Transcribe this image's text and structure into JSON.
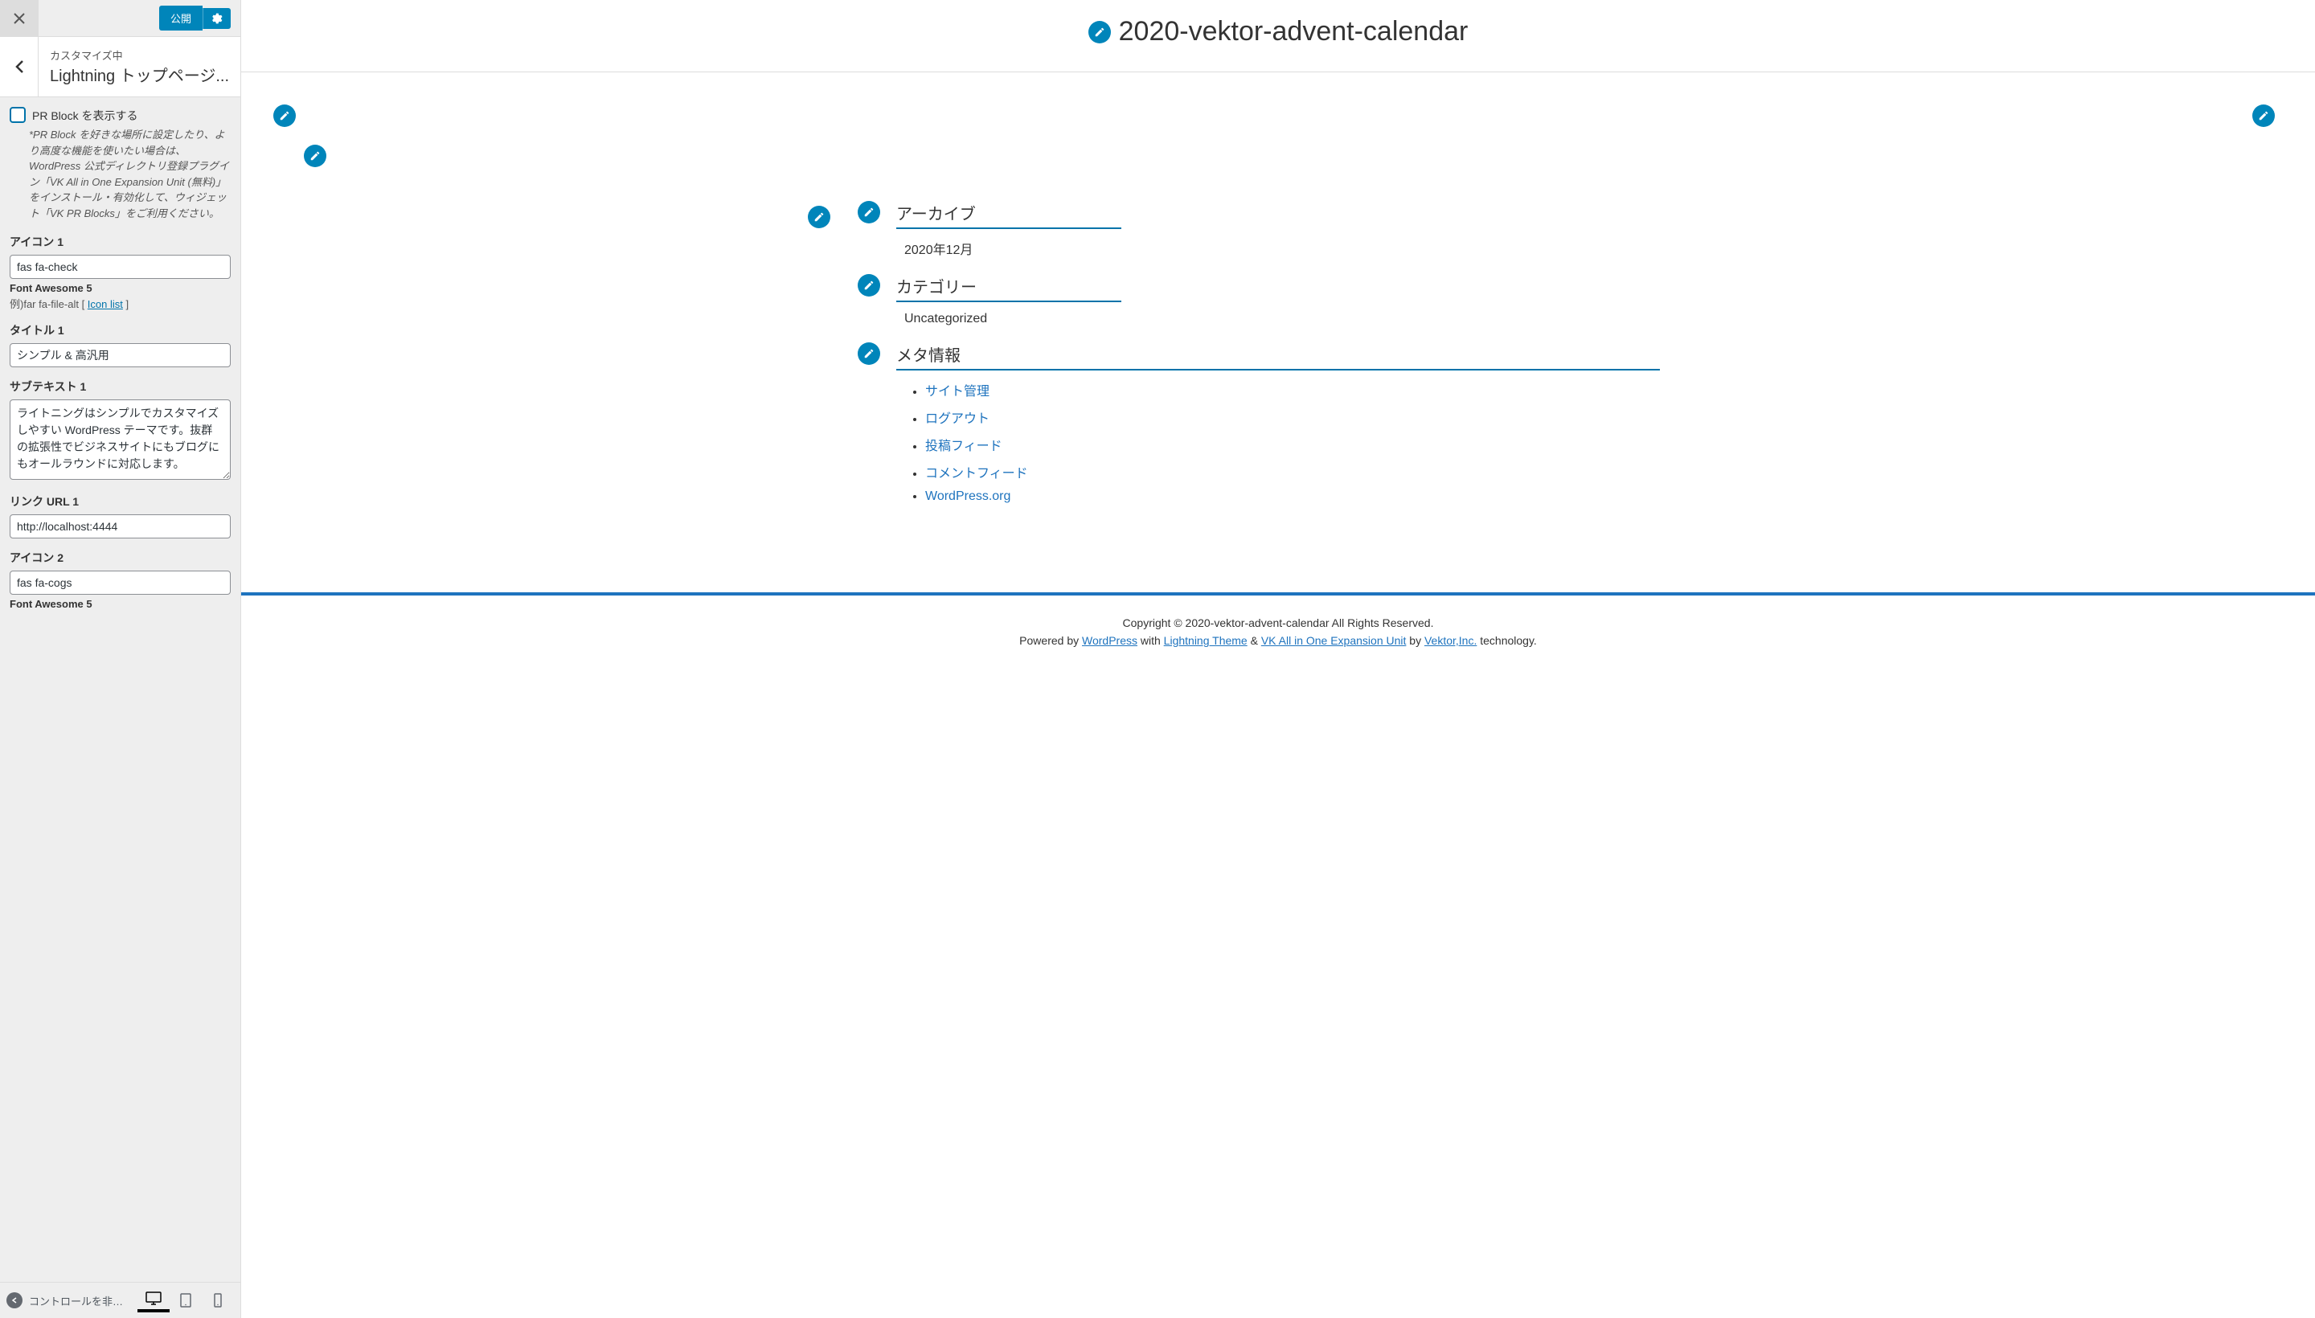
{
  "sidebar": {
    "publish_label": "公開",
    "customize_label": "カスタマイズ中",
    "section_title": "Lightning トップページ...",
    "checkbox_label": "PR Block を表示する",
    "help_text": "*PR Block を好きな場所に設定したり、より高度な機能を使いたい場合は、WordPress 公式ディレクトリ登録プラグイン「VK All in One Expansion Unit (無料)」をインストール・有効化して、ウィジェット「VK PR Blocks」をご利用ください。",
    "fields": {
      "icon1_label": "アイコン 1",
      "icon1_value": "fas fa-check",
      "font_awesome": "Font Awesome 5",
      "example_prefix": "例)far fa-file-alt [ ",
      "icon_list": "Icon list",
      "example_suffix": " ]",
      "title1_label": "タイトル 1",
      "title1_value": "シンプル & 高汎用",
      "subtext1_label": "サブテキスト 1",
      "subtext1_value": "ライトニングはシンプルでカスタマイズしやすい WordPress テーマです。抜群の拡張性でビジネスサイトにもブログにもオールラウンドに対応します。",
      "link1_label": "リンク URL 1",
      "link1_value": "http://localhost:4444",
      "icon2_label": "アイコン 2",
      "icon2_value": "fas fa-cogs"
    },
    "collapse_label": "コントロールを非表示"
  },
  "preview": {
    "site_title": "2020-vektor-advent-calendar",
    "widgets": {
      "archive_title": "アーカイブ",
      "archive_item": "2020年12月",
      "category_title": "カテゴリー",
      "category_item": "Uncategorized",
      "meta_title": "メタ情報",
      "meta_links": [
        "サイト管理",
        "ログアウト",
        "投稿フィード",
        "コメントフィード",
        "WordPress.org"
      ]
    },
    "footer": {
      "copyright": "Copyright © 2020-vektor-advent-calendar All Rights Reserved.",
      "powered_prefix": "Powered by ",
      "wordpress": "WordPress",
      "with": " with ",
      "lightning": "Lightning Theme",
      "amp": " & ",
      "vk_unit": "VK All in One Expansion Unit",
      "by": " by ",
      "vektor": "Vektor,Inc.",
      "tech": " technology."
    }
  }
}
